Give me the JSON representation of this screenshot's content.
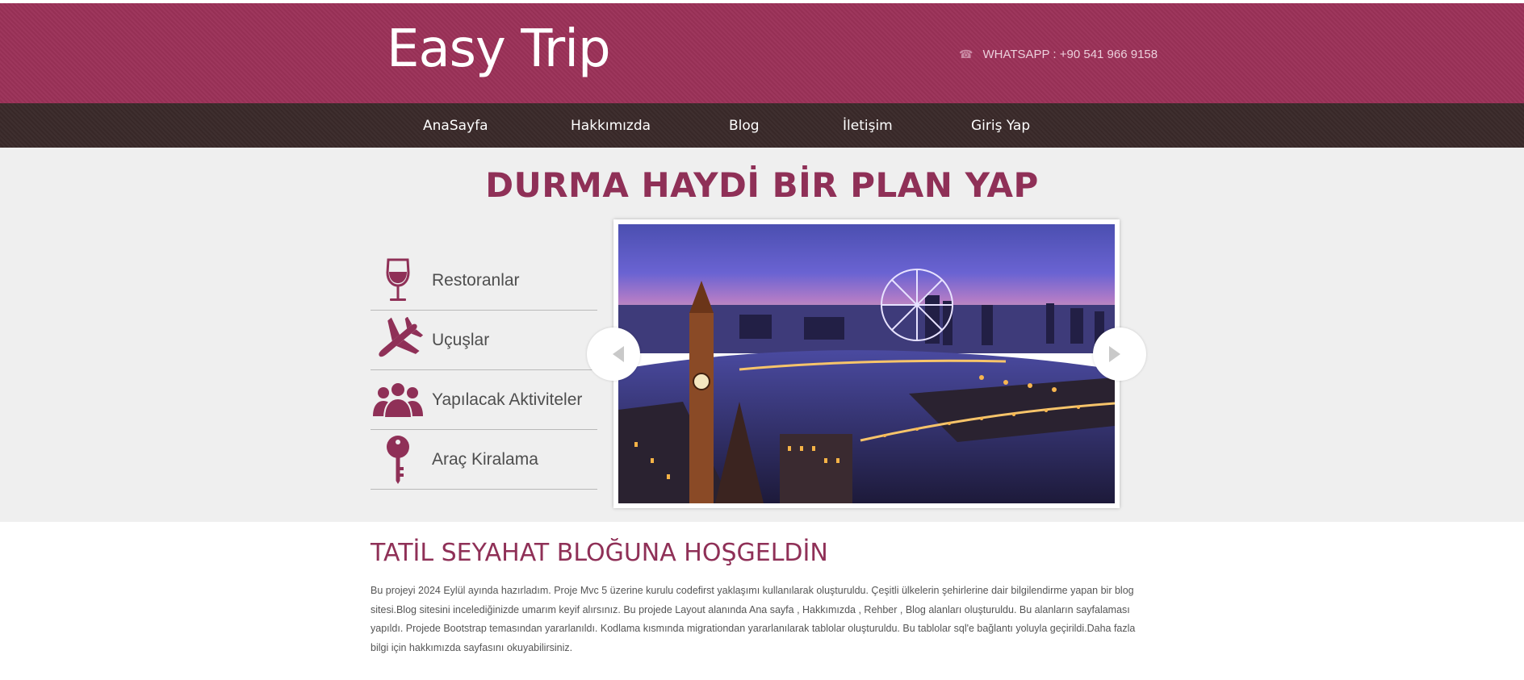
{
  "header": {
    "logo": "Easy Trip",
    "contact": "WHATSAPP : +90 541 966 9158"
  },
  "nav": {
    "items": [
      "AnaSayfa",
      "Hakkımızda",
      "Blog",
      "İletişim",
      "Giriş Yap"
    ]
  },
  "hero": {
    "title": "DURMA HAYDİ BİR PLAN YAP",
    "services": [
      {
        "label": "Restoranlar",
        "icon": "wine-glass-icon"
      },
      {
        "label": "Uçuşlar",
        "icon": "airplane-icon"
      },
      {
        "label": "Yapılacak Aktiviteler",
        "icon": "people-icon"
      },
      {
        "label": "Araç Kiralama",
        "icon": "key-icon"
      }
    ]
  },
  "welcome": {
    "title": "TATİL SEYAHAT BLOĞUNA HOŞGELDİN",
    "text": "Bu projeyi 2024 Eylül ayında hazırladım. Proje Mvc 5 üzerine kurulu codefirst yaklaşımı kullanılarak oluşturuldu. Çeşitli ülkelerin şehirlerine dair bilgilendirme yapan bir blog sitesi.Blog sitesini incelediğinizde umarım keyif alırsınız. Bu projede Layout alanında Ana sayfa , Hakkımızda , Rehber , Blog alanları oluşturuldu. Bu alanların sayfalaması yapıldı. Projede Bootstrap temasından yararlanıldı. Kodlama kısmında migrationdan yararlanılarak tablolar oluşturuldu. Bu tablolar sql'e bağlantı yoluyla geçirildi.Daha fazla bilgi için hakkımızda sayfasını okuyabilirsiniz."
  },
  "colors": {
    "brand": "#9b3158",
    "nav": "#3a2a2a",
    "accent": "#8f3057"
  }
}
